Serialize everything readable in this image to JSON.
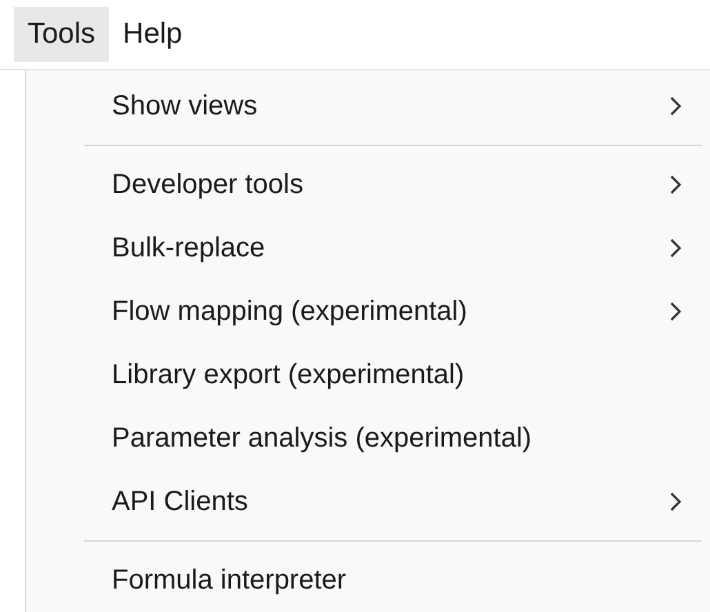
{
  "menu_bar": [
    {
      "label": "Tools",
      "selected": true
    },
    {
      "label": "Help",
      "selected": false
    }
  ],
  "menu": [
    {
      "kind": "item",
      "label": "Show views",
      "submenu": true
    },
    {
      "kind": "separator"
    },
    {
      "kind": "item",
      "label": "Developer tools",
      "submenu": true
    },
    {
      "kind": "item",
      "label": "Bulk-replace",
      "submenu": true
    },
    {
      "kind": "item",
      "label": "Flow mapping (experimental)",
      "submenu": true
    },
    {
      "kind": "item",
      "label": "Library export (experimental)",
      "submenu": false
    },
    {
      "kind": "item",
      "label": "Parameter analysis (experimental)",
      "submenu": false
    },
    {
      "kind": "item",
      "label": "API Clients",
      "submenu": true
    },
    {
      "kind": "separator"
    },
    {
      "kind": "item",
      "label": "Formula interpreter",
      "submenu": false
    }
  ]
}
